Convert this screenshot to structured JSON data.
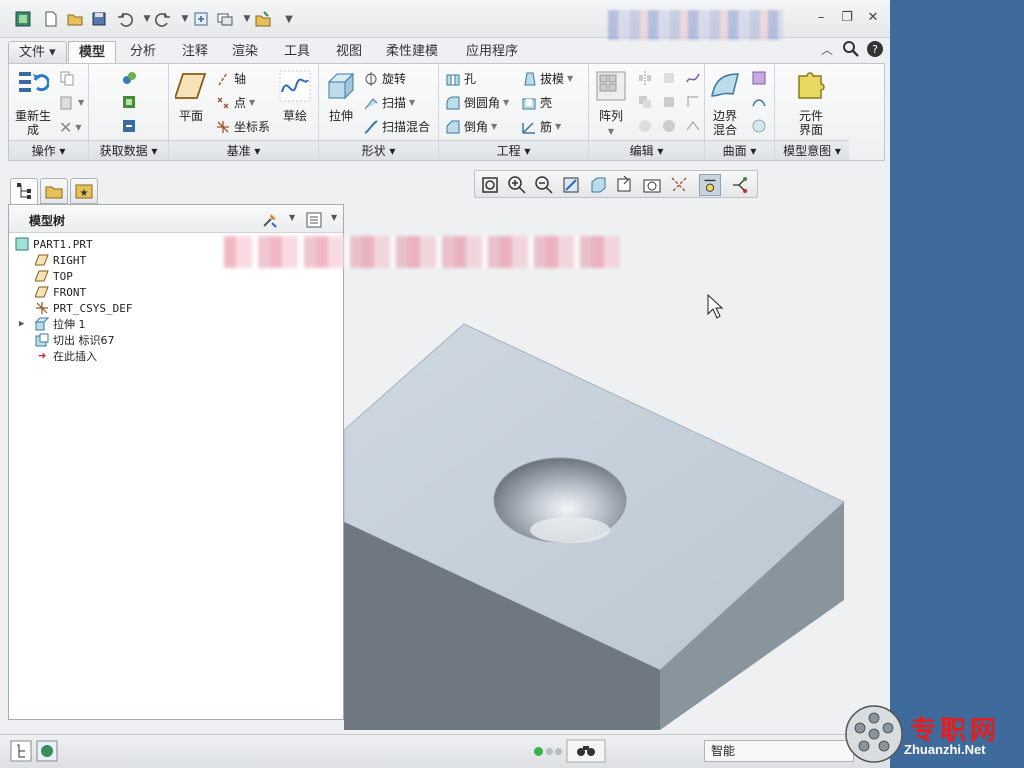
{
  "ribbon_tabs": [
    "文件",
    "模型",
    "分析",
    "注释",
    "渲染",
    "工具",
    "视图",
    "柔性建模",
    "应用程序"
  ],
  "groups": {
    "operations": {
      "label": "操作",
      "regenerate": "重新生\n成"
    },
    "get_data": {
      "label": "获取数据"
    },
    "datum": {
      "label": "基准",
      "plane": "平面",
      "axis": "轴",
      "point": "点",
      "csys": "坐标系",
      "sketch": "草绘"
    },
    "shapes": {
      "label": "形状",
      "extrude": "拉伸",
      "revolve": "旋转",
      "sweep": "扫描",
      "swept_blend": "扫描混合"
    },
    "engineering": {
      "label": "工程",
      "hole": "孔",
      "round": "倒圆角",
      "chamfer": "倒角",
      "draft": "拔模",
      "shell": "壳",
      "rib": "筋"
    },
    "editing": {
      "label": "编辑",
      "pattern": "阵列"
    },
    "surfaces": {
      "label": "曲面",
      "boundary_blend": "边界\n混合"
    },
    "model_intent": {
      "label": "模型意图",
      "component_interface": "元件\n界面"
    }
  },
  "model_tree": {
    "title": "模型树",
    "items": [
      {
        "label": "PART1.PRT"
      },
      {
        "label": "RIGHT"
      },
      {
        "label": "TOP"
      },
      {
        "label": "FRONT"
      },
      {
        "label": "PRT_CSYS_DEF"
      },
      {
        "label": "拉伸 1"
      },
      {
        "label": "切出 标识67"
      },
      {
        "label": "在此插入"
      }
    ]
  },
  "status": {
    "filter": "智能"
  },
  "watermark": {
    "cn": "专职网",
    "en": "Zhuanzhi.Net"
  },
  "colors": {
    "accent": "#3f6b9c",
    "part_top": "#c6d1dc",
    "part_front": "#6f7880",
    "part_side": "#8a949c"
  }
}
